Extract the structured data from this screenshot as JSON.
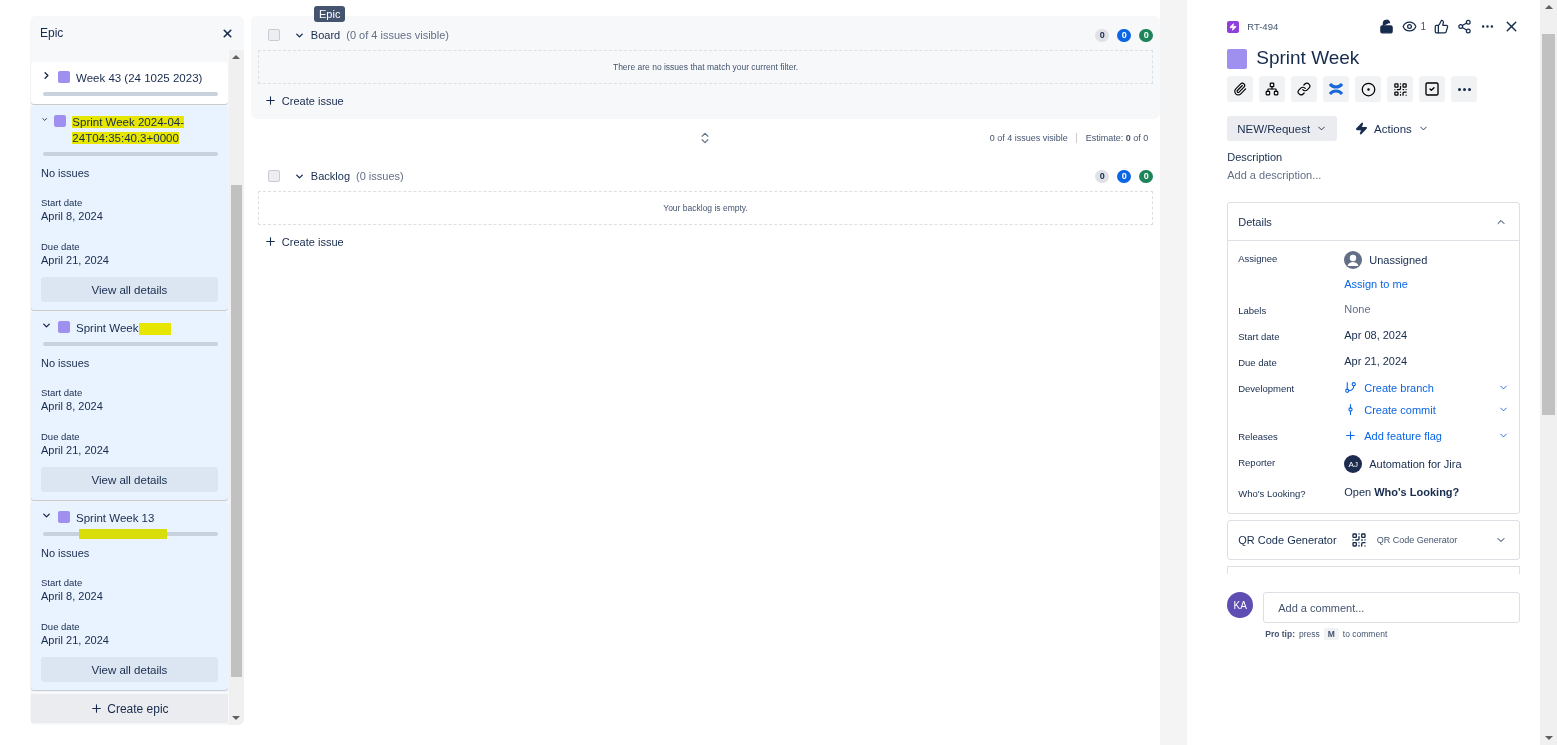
{
  "tooltip": "Epic",
  "epic_panel": {
    "title": "Epic",
    "create_label": "Create epic",
    "epics": [
      {
        "name": "Week 43 (24 1025 2023)",
        "expanded": false,
        "name_marked": false,
        "mark_after_name": false,
        "bar_marked": false,
        "color": "#9f8fef"
      },
      {
        "name": "Sprint Week 2024-04-24T04:35:40.3+0000",
        "expanded": true,
        "name_marked": true,
        "mark_after_name": false,
        "bar_marked": false,
        "color": "#9f8fef",
        "status": "No issues",
        "start_label": "Start date",
        "start": "April 8, 2024",
        "due_label": "Due date",
        "due": "April 21, 2024",
        "details_label": "View all details"
      },
      {
        "name": "Sprint Week",
        "expanded": true,
        "name_marked": false,
        "mark_after_name": true,
        "bar_marked": false,
        "color": "#9f8fef",
        "status": "No issues",
        "start_label": "Start date",
        "start": "April 8, 2024",
        "due_label": "Due date",
        "due": "April 21, 2024",
        "details_label": "View all details"
      },
      {
        "name": "Sprint Week 13",
        "expanded": true,
        "name_marked": false,
        "mark_after_name": false,
        "bar_marked": true,
        "color": "#9f8fef",
        "status": "No issues",
        "start_label": "Start date",
        "start": "April 8, 2024",
        "due_label": "Due date",
        "due": "April 21, 2024",
        "details_label": "View all details"
      }
    ]
  },
  "sprints": [
    {
      "kind": "board",
      "checked": false,
      "name": "Board",
      "count": "(0 of 4 issues visible)",
      "badges": [
        "0",
        "0",
        "0"
      ],
      "empty": "There are no issues that match your current filter.",
      "create": "Create issue"
    },
    {
      "kind": "backlog",
      "checked": false,
      "name": "Backlog",
      "count": "(0 issues)",
      "badges": [
        "0",
        "0",
        "0"
      ],
      "empty": "Your backlog is empty.",
      "create": "Create issue"
    }
  ],
  "summary": {
    "visible": "0 of 4 issues visible",
    "estimate_label": "Estimate:",
    "estimate_value": "0 of 0"
  },
  "issue": {
    "key": "RT-494",
    "watchers": "1",
    "title": "Sprint Week",
    "status": "NEW/Request",
    "actions": "Actions",
    "description_label": "Description",
    "description_placeholder": "Add a description...",
    "details_title": "Details",
    "details": [
      {
        "kind": "user",
        "label": "Assignee",
        "value": "Unassigned",
        "link": "Assign to me"
      },
      {
        "kind": "muted",
        "label": "Labels",
        "value": "None"
      },
      {
        "kind": "plain",
        "label": "Start date",
        "value": "Apr 08, 2024"
      },
      {
        "kind": "plain",
        "label": "Due date",
        "value": "Apr 21, 2024"
      },
      {
        "kind": "dev",
        "label": "Development",
        "links": [
          "Create branch",
          "Create commit"
        ]
      },
      {
        "kind": "flag",
        "label": "Releases",
        "links": [
          "Add feature flag"
        ]
      },
      {
        "kind": "avatar",
        "label": "Reporter",
        "initials": "AJ",
        "value": "Automation for Jira"
      },
      {
        "kind": "rich",
        "label": "Who's Looking?",
        "value": "Open **Who's Looking?**"
      }
    ],
    "qr_title": "QR Code Generator",
    "qr_value": "QR Code Generator",
    "commenter": "KA",
    "comment_placeholder": "Add a comment...",
    "tip_label": "Pro tip:",
    "tip_before": "press",
    "tip_key": "M",
    "tip_after": "to comment"
  }
}
